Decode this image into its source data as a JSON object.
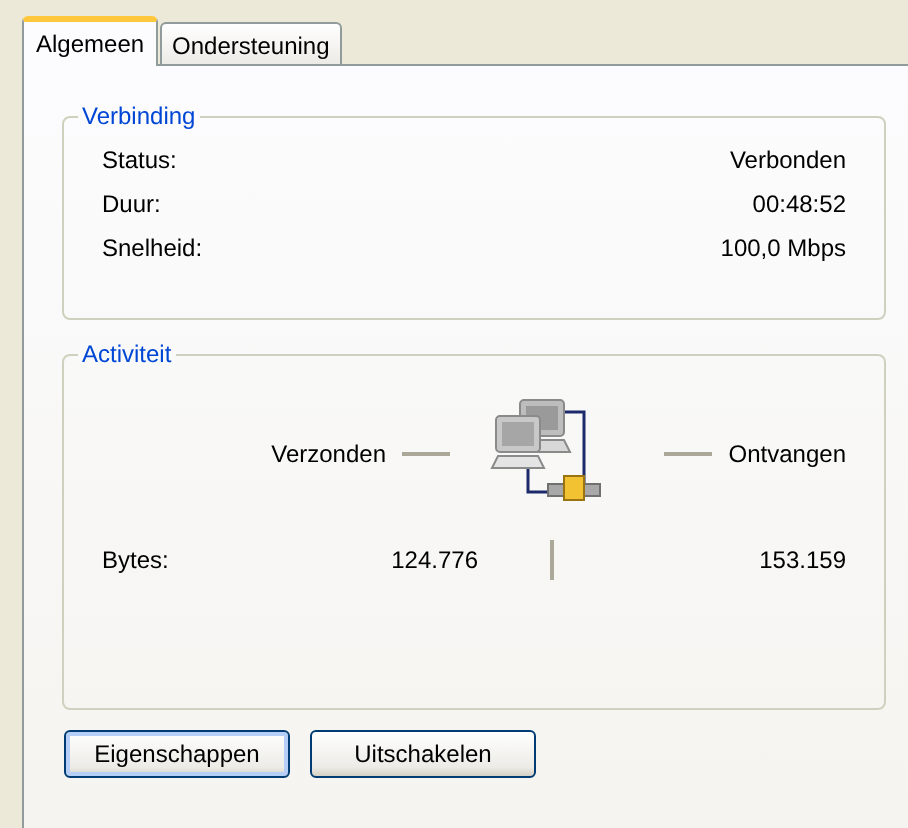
{
  "tabs": [
    {
      "label": "Algemeen",
      "selected": true
    },
    {
      "label": "Ondersteuning",
      "selected": false
    }
  ],
  "connection": {
    "title": "Verbinding",
    "rows": [
      {
        "label": "Status:",
        "value": "Verbonden"
      },
      {
        "label": "Duur:",
        "value": "00:48:52"
      },
      {
        "label": "Snelheid:",
        "value": "100,0 Mbps"
      }
    ]
  },
  "activity": {
    "title": "Activiteit",
    "sent_label": "Verzonden",
    "received_label": "Ontvangen",
    "row_label": "Bytes:",
    "sent": "124.776",
    "received": "153.159"
  },
  "buttons": [
    {
      "label": "Eigenschappen",
      "focused": true
    },
    {
      "label": "Uitschakelen",
      "focused": false
    }
  ]
}
